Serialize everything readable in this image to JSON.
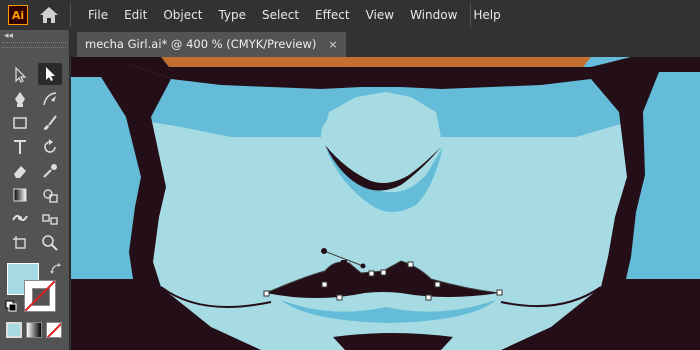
{
  "app": {
    "logo_text": "Ai"
  },
  "menu": [
    "File",
    "Edit",
    "Object",
    "Type",
    "Select",
    "Effect",
    "View",
    "Window",
    "Help"
  ],
  "tab": {
    "title": "mecha Girl.ai* @ 400 % (CMYK/Preview)",
    "close": "×"
  },
  "toolbar": {
    "collapse": "◂◂",
    "tools": [
      "selection",
      "direct-selection",
      "pen",
      "curvature",
      "rectangle",
      "paintbrush",
      "type",
      "rotate",
      "eraser",
      "eyedropper",
      "gradient",
      "shape-builder",
      "puppet-warp",
      "blend",
      "artboard",
      "zoom"
    ]
  },
  "colors": {
    "fill": "#a6dbe4",
    "skin_light": "#a6dbe4",
    "skin_shadow": "#64bcd9",
    "outline": "#240f18",
    "hair_accent": "#c26f2f",
    "ui_dark": "#323232",
    "ui_panel": "#535353"
  }
}
